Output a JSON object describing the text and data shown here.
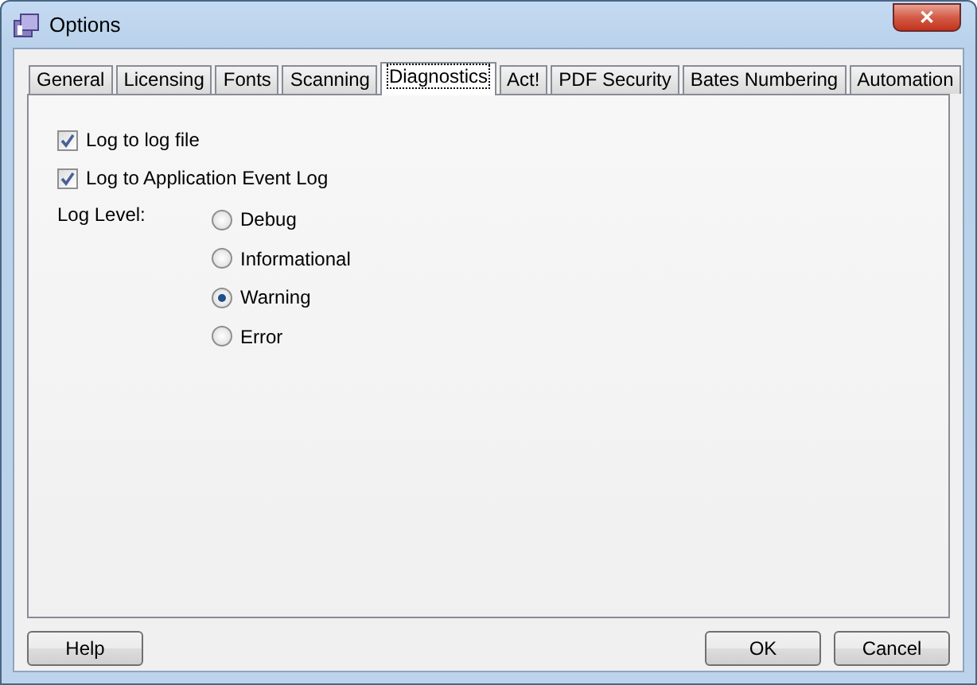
{
  "window": {
    "title": "Options",
    "close": "✕"
  },
  "tabs": [
    {
      "label": "General",
      "selected": false
    },
    {
      "label": "Licensing",
      "selected": false
    },
    {
      "label": "Fonts",
      "selected": false
    },
    {
      "label": "Scanning",
      "selected": false
    },
    {
      "label": "Diagnostics",
      "selected": true
    },
    {
      "label": "Act!",
      "selected": false
    },
    {
      "label": "PDF Security",
      "selected": false
    },
    {
      "label": "Bates Numbering",
      "selected": false
    },
    {
      "label": "Automation",
      "selected": false
    }
  ],
  "checkboxes": [
    {
      "label": "Log to log file",
      "checked": true
    },
    {
      "label": "Log to Application Event Log",
      "checked": true
    }
  ],
  "log_level": {
    "label": "Log Level:",
    "options": [
      {
        "label": "Debug",
        "selected": false
      },
      {
        "label": "Informational",
        "selected": false
      },
      {
        "label": "Warning",
        "selected": true
      },
      {
        "label": "Error",
        "selected": false
      }
    ]
  },
  "buttons": {
    "help": "Help",
    "ok": "OK",
    "cancel": "Cancel"
  }
}
